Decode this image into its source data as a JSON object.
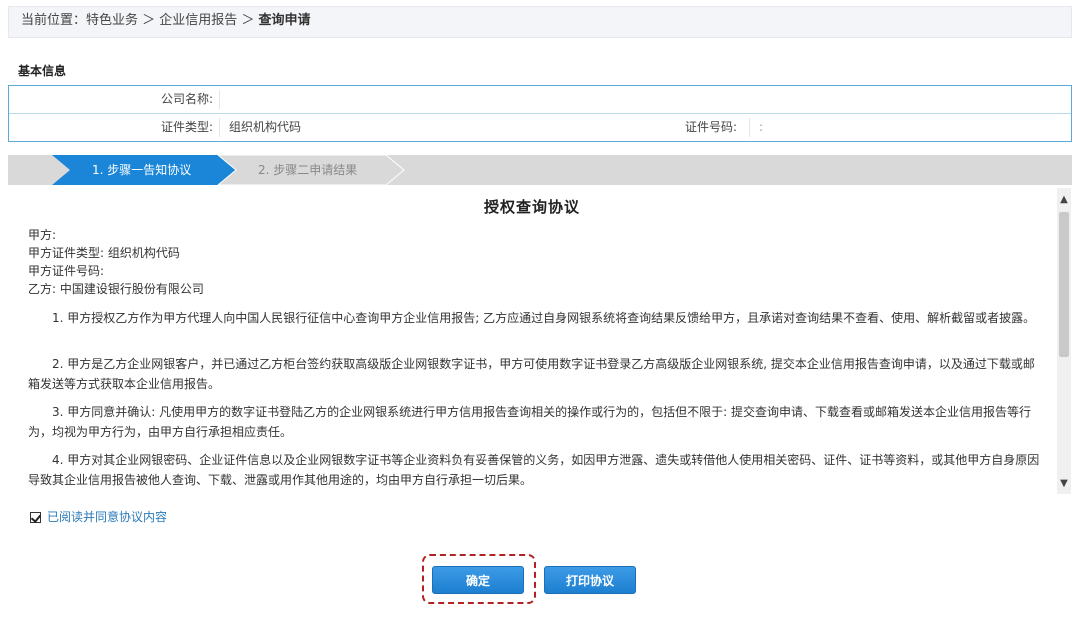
{
  "breadcrumb": {
    "prefix": "当前位置：特色业务 ＞ 企业信用报告 ＞ ",
    "current": "查询申请"
  },
  "basic_info": {
    "section_title": "基本信息",
    "company_name_label": "公司名称:",
    "company_name_value": "",
    "id_type_label": "证件类型:",
    "id_type_value": "组织机构代码",
    "id_number_label": "证件号码:",
    "id_number_value": ":"
  },
  "steps": [
    {
      "label": "1. 步骤一告知协议",
      "active": true
    },
    {
      "label": "2. 步骤二申请结果",
      "active": false
    }
  ],
  "agreement": {
    "title": "授权查询协议",
    "party_lines": [
      "甲方:",
      "甲方证件类型: 组织机构代码",
      "甲方证件号码:",
      "乙方: 中国建设银行股份有限公司"
    ],
    "paragraphs": [
      "1. 甲方授权乙方作为甲方代理人向中国人民银行征信中心查询甲方企业信用报告; 乙方应通过自身网银系统将查询结果反馈给甲方，且承诺对查询结果不查看、使用、解析截留或者披露。",
      "2. 甲方是乙方企业网银客户，并已通过乙方柜台签约获取高级版企业网银数字证书，甲方可使用数字证书登录乙方高级版企业网银系统, 提交本企业信用报告查询申请，以及通过下载或邮箱发送等方式获取本企业信用报告。",
      "3. 甲方同意并确认: 凡使用甲方的数字证书登陆乙方的企业网银系统进行甲方信用报告查询相关的操作或行为的，包括但不限于: 提交查询申请、下载查看或邮箱发送本企业信用报告等行为，均视为甲方行为，由甲方自行承担相应责任。",
      "4. 甲方对其企业网银密码、企业证件信息以及企业网银数字证书等企业资料负有妥善保管的义务，如因甲方泄露、遗失或转借他人使用相关密码、证件、证书等资料，或其他甲方自身原因导致其企业信用报告被他人查询、下载、泄露或用作其他用途的，均由甲方自行承担一切后果。"
    ]
  },
  "consent": {
    "checked": true,
    "label": "已阅读并同意协议内容"
  },
  "buttons": {
    "confirm": "确定",
    "print": "打印协议"
  },
  "colors": {
    "step_active": "#1b86d8",
    "step_inactive": "#d9d9d9",
    "button": "#1d7fd1",
    "border_accent": "#5aa9d6",
    "highlight": "#b22222"
  }
}
